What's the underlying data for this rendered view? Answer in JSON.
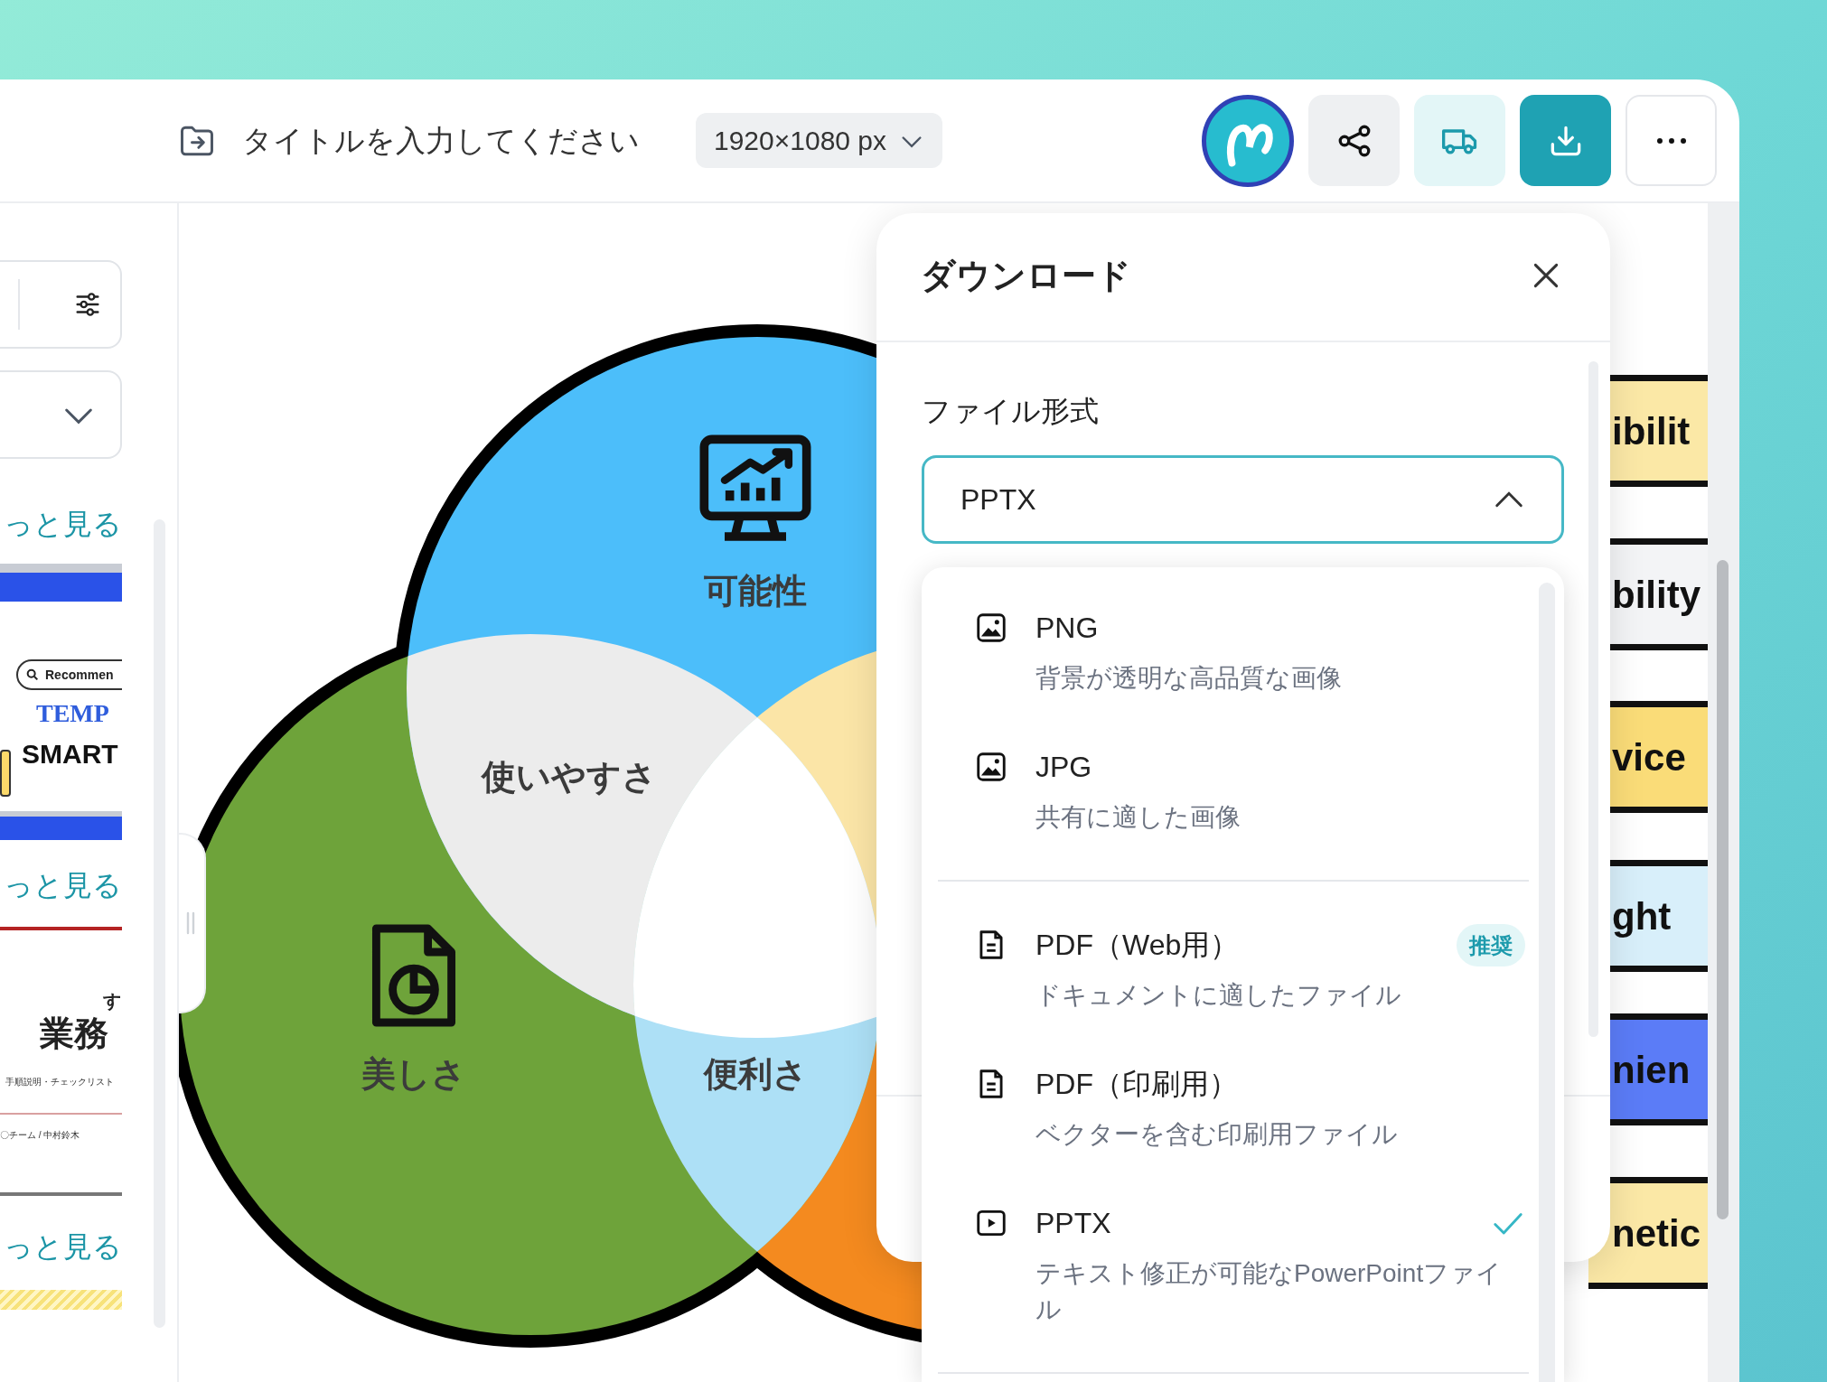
{
  "header": {
    "title_field": {
      "placeholder": "タイトルを入力してください"
    },
    "size_select": {
      "value": "1920×1080 px"
    }
  },
  "sidebar": {
    "sections": [
      {
        "link": "っと見る",
        "thumbnail": {
          "kind": "banner",
          "texts": [
            "Recommen",
            "TEMP",
            "SMART"
          ]
        }
      },
      {
        "link": "っと見る",
        "thumbnail": {
          "kind": "document",
          "texts": [
            "す",
            "業務",
            "手順説明・チェックリスト",
            "〇チーム / 中村鈴木"
          ]
        }
      },
      {
        "link": "っと見る",
        "thumbnail": {
          "kind": "striped"
        }
      }
    ]
  },
  "diagram": {
    "labels": [
      "可能性",
      "使いやすさ",
      "美しさ",
      "便利さ"
    ]
  },
  "cards": [
    {
      "text": "ibilit",
      "color": "#fbe8a6"
    },
    {
      "text": "bility",
      "color": "#f3f4f6"
    },
    {
      "text": "vice",
      "color": "#fadc78"
    },
    {
      "text": "ght",
      "color": "#d8effa"
    },
    {
      "text": "nien",
      "color": "#5b7cf7"
    },
    {
      "text": "netic",
      "color": "#fbe8a6"
    }
  ],
  "download_panel": {
    "title": "ダウンロード",
    "format_label": "ファイル形式",
    "format_select": {
      "value": "PPTX",
      "expanded": true
    },
    "options": [
      {
        "kind": "image",
        "label": "PNG",
        "description": "背景が透明な高品質な画像",
        "selected": false
      },
      {
        "kind": "image",
        "label": "JPG",
        "description": "共有に適した画像",
        "selected": false
      },
      {
        "kind": "document",
        "label": "PDF（Web用）",
        "description": "ドキュメントに適したファイル",
        "badge": "推奨",
        "selected": false
      },
      {
        "kind": "document",
        "label": "PDF（印刷用）",
        "description": "ベクターを含む印刷用ファイル",
        "selected": false
      },
      {
        "kind": "presentation",
        "label": "PPTX",
        "description": "テキスト修正が可能なPowerPointファイル",
        "selected": true
      }
    ]
  }
}
